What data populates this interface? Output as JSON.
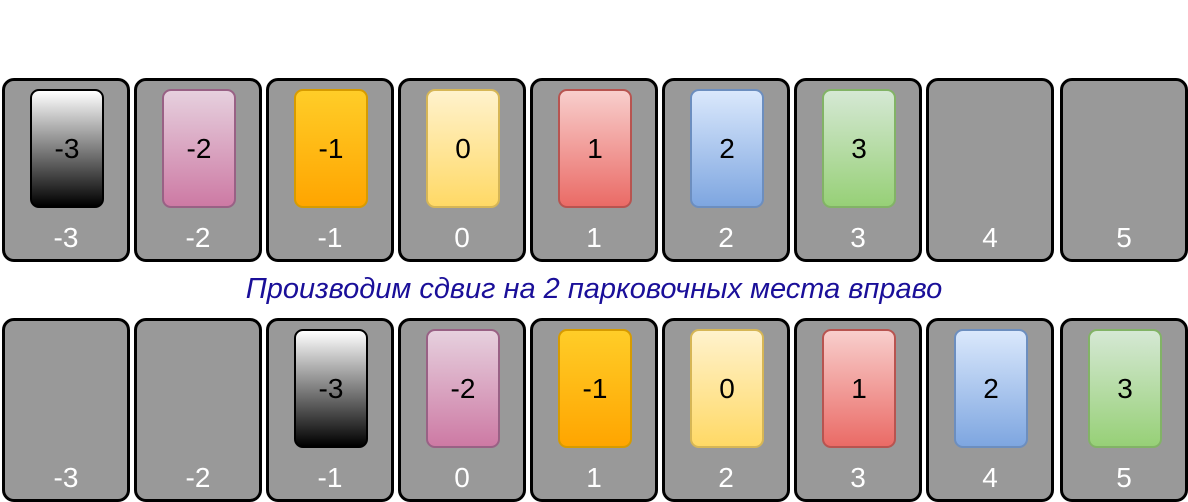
{
  "slot_labels": [
    "-3",
    "-2",
    "-1",
    "0",
    "1",
    "2",
    "3",
    "4",
    "5"
  ],
  "caption": "Производим сдвиг на 2 парковочных места вправо",
  "cars": [
    {
      "label": "-3",
      "fill_top": "#ffffff",
      "fill_bottom": "#000000",
      "stroke": "#000000"
    },
    {
      "label": "-2",
      "fill_top": "#e6d0de",
      "fill_bottom": "#cd7aa4",
      "stroke": "#996185"
    },
    {
      "label": "-1",
      "fill_top": "#ffcd28",
      "fill_bottom": "#ffa500",
      "stroke": "#d79b00"
    },
    {
      "label": "0",
      "fill_top": "#fff2cc",
      "fill_bottom": "#ffd966",
      "stroke": "#d6b656"
    },
    {
      "label": "1",
      "fill_top": "#f8cecc",
      "fill_bottom": "#ea6b66",
      "stroke": "#b85450"
    },
    {
      "label": "2",
      "fill_top": "#dae8fc",
      "fill_bottom": "#7ea6e0",
      "stroke": "#6c8ebf"
    },
    {
      "label": "3",
      "fill_top": "#d5e8d4",
      "fill_bottom": "#97d077",
      "stroke": "#82b366"
    }
  ],
  "rows": {
    "before": {
      "car_slots": [
        "-3",
        "-2",
        "-1",
        "0",
        "1",
        "2",
        "3"
      ]
    },
    "after": {
      "car_slots": [
        "-1",
        "0",
        "1",
        "2",
        "3",
        "4",
        "5"
      ]
    }
  },
  "colors": {
    "slot_fill": "#999999",
    "slot_border": "#000000",
    "slot_label": "#ffffff",
    "caption": "#1a0f99"
  }
}
